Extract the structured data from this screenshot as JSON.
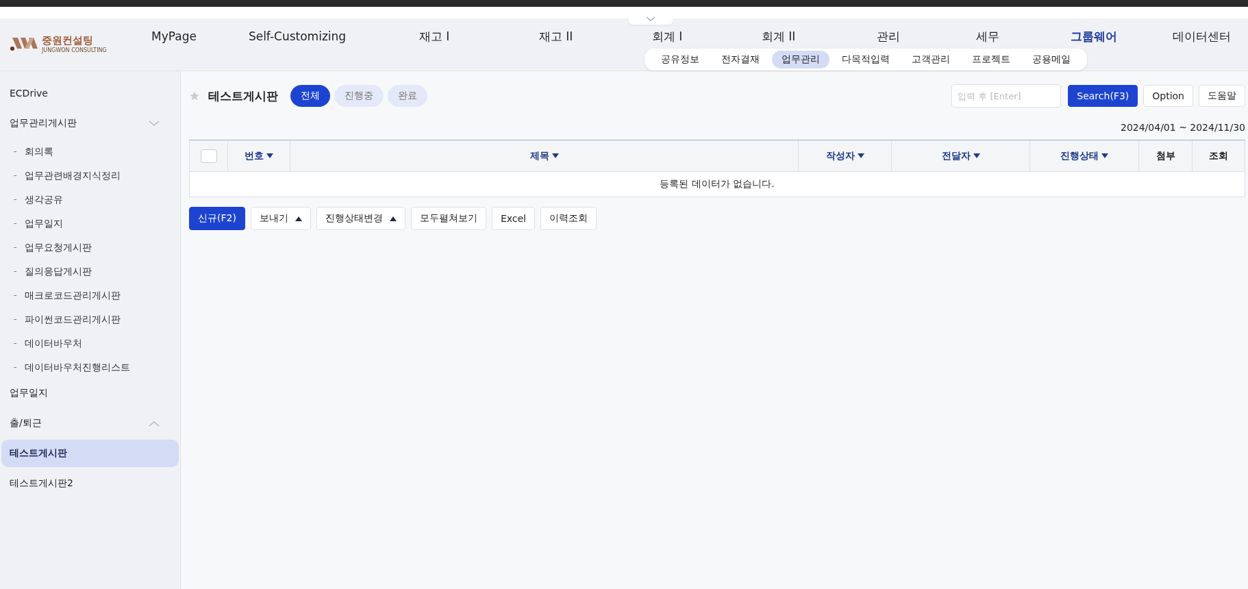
{
  "header": {
    "logo": {
      "name": "중원컨설팅",
      "subtitle": "JUNGWON CONSULTING"
    },
    "nav": [
      {
        "label": "MyPage",
        "selected": false
      },
      {
        "label": "Self-Customizing",
        "selected": false
      },
      {
        "label": "재고 I",
        "selected": false
      },
      {
        "label": "재고 II",
        "selected": false
      },
      {
        "label": "회계 I",
        "selected": false
      },
      {
        "label": "회계 II",
        "selected": false
      },
      {
        "label": "관리",
        "selected": false
      },
      {
        "label": "세무",
        "selected": false
      },
      {
        "label": "그룹웨어",
        "selected": true
      },
      {
        "label": "데이터센터",
        "selected": false
      }
    ],
    "submenu": [
      {
        "label": "공유정보",
        "selected": false
      },
      {
        "label": "전자결재",
        "selected": false
      },
      {
        "label": "업무관리",
        "selected": true
      },
      {
        "label": "다목적입력",
        "selected": false
      },
      {
        "label": "고객관리",
        "selected": false
      },
      {
        "label": "프로젝트",
        "selected": false
      },
      {
        "label": "공용메일",
        "selected": false
      }
    ]
  },
  "sidebar": {
    "items": [
      {
        "label": "ECDrive",
        "kind": "link",
        "selected": false
      },
      {
        "label": "업무관리게시판",
        "kind": "group",
        "expanded": true,
        "children": [
          {
            "label": "회의록",
            "selected": false
          },
          {
            "label": "업무관련배경지식정리",
            "selected": false
          },
          {
            "label": "생각공유",
            "selected": false
          },
          {
            "label": "업무일지",
            "selected": false
          },
          {
            "label": "업무요청게시판",
            "selected": false
          },
          {
            "label": "질의응답게시판",
            "selected": false
          },
          {
            "label": "매크로코드관리게시판",
            "selected": false
          },
          {
            "label": "파이썬코드관리게시판",
            "selected": false
          },
          {
            "label": "데이터바우처",
            "selected": false
          },
          {
            "label": "데이터바우처진행리스트",
            "selected": false
          }
        ]
      },
      {
        "label": "업무일지",
        "kind": "link",
        "selected": false
      },
      {
        "label": "출/퇴근",
        "kind": "group",
        "expanded": false
      },
      {
        "label": "테스트게시판",
        "kind": "link",
        "selected": true
      },
      {
        "label": "테스트게시판2",
        "kind": "link",
        "selected": false
      }
    ]
  },
  "content": {
    "title": "테스트게시판",
    "favorite": false,
    "filters": [
      {
        "label": "전체",
        "selected": true
      },
      {
        "label": "진행중",
        "selected": false
      },
      {
        "label": "완료",
        "selected": false
      }
    ],
    "search": {
      "placeholder": "입력 후 [Enter]"
    },
    "top_buttons": [
      {
        "label": "Search(F3)",
        "primary": true
      },
      {
        "label": "Option",
        "primary": false
      },
      {
        "label": "도움말",
        "primary": false
      }
    ],
    "date_range": "2024/04/01 ~ 2024/11/30",
    "table": {
      "select_all_checked": false,
      "columns": [
        {
          "label": "번호",
          "sortable": true
        },
        {
          "label": "제목",
          "sortable": true
        },
        {
          "label": "작성자",
          "sortable": true
        },
        {
          "label": "전달자",
          "sortable": true
        },
        {
          "label": "진행상태",
          "sortable": true
        },
        {
          "label": "첨부",
          "sortable": false
        },
        {
          "label": "조회",
          "sortable": false
        }
      ],
      "empty_message": "등록된 데이터가 없습니다."
    },
    "actions": [
      {
        "label": "신규(F2)",
        "primary": true,
        "caret": false
      },
      {
        "label": "보내기",
        "primary": false,
        "caret": true
      },
      {
        "label": "진행상태변경",
        "primary": false,
        "caret": true
      },
      {
        "label": "모두펼쳐보기",
        "primary": false,
        "caret": false
      },
      {
        "label": "Excel",
        "primary": false,
        "caret": false
      },
      {
        "label": "이력조회",
        "primary": false,
        "caret": false
      }
    ]
  }
}
